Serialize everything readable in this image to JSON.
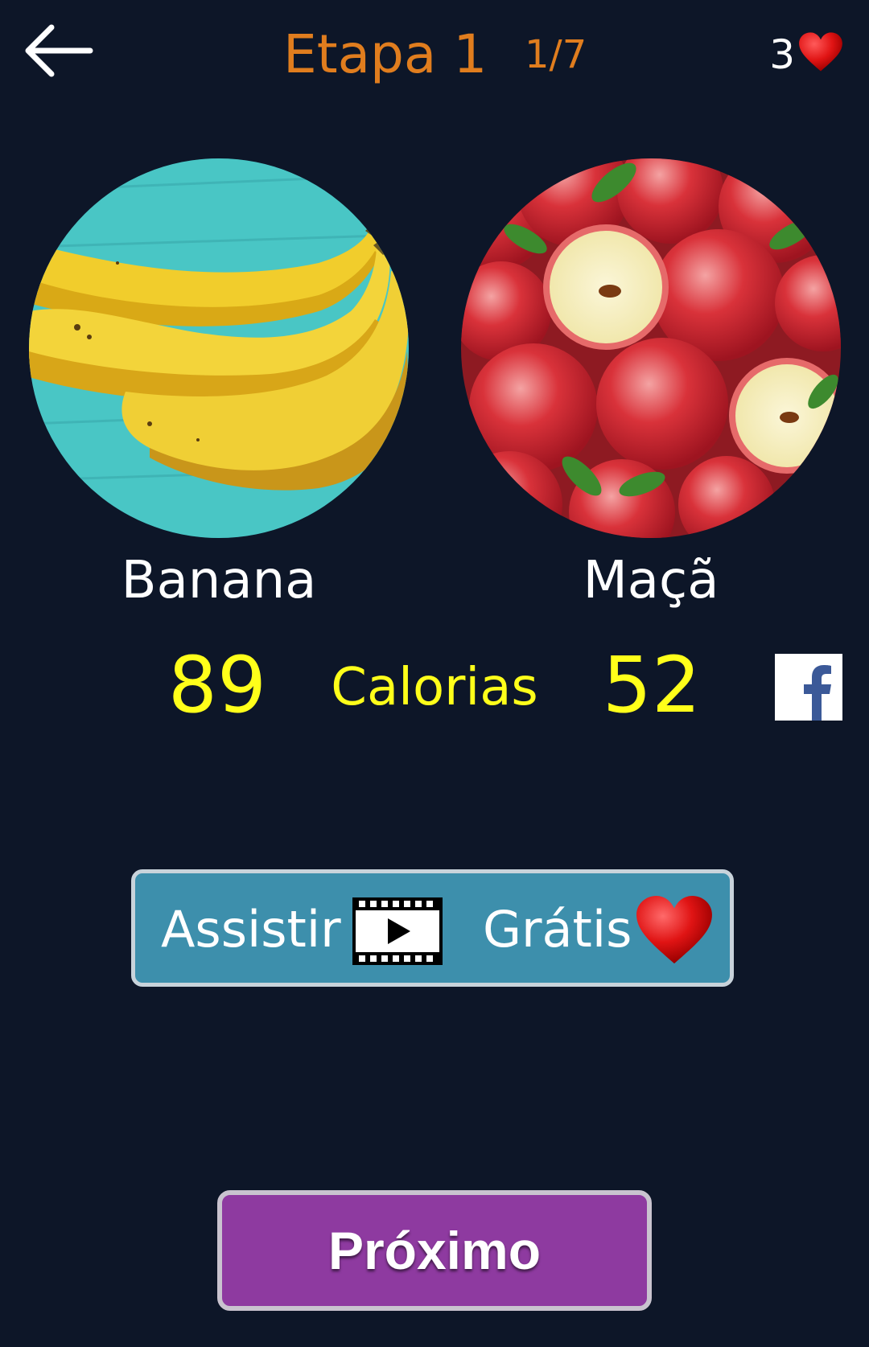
{
  "header": {
    "title": "Etapa 1",
    "progress": "1/7",
    "lives": "3"
  },
  "left_item": {
    "name": "Banana",
    "calories": "89"
  },
  "right_item": {
    "name": "Maçã",
    "calories": "52"
  },
  "calories_label": "Calorias",
  "watch_button": {
    "label": "Assistir",
    "free_label": "Grátis"
  },
  "next_button": {
    "label": "Próximo"
  },
  "icons": [
    "back-arrow-icon",
    "heart-icon",
    "film-play-icon",
    "facebook-icon"
  ],
  "colors": {
    "background": "#0d1628",
    "title": "#e07d1e",
    "calories": "#ffff1a",
    "watch_button": "#3d8fac",
    "next_button": "#8e3aa0",
    "heart": "#e01414"
  }
}
